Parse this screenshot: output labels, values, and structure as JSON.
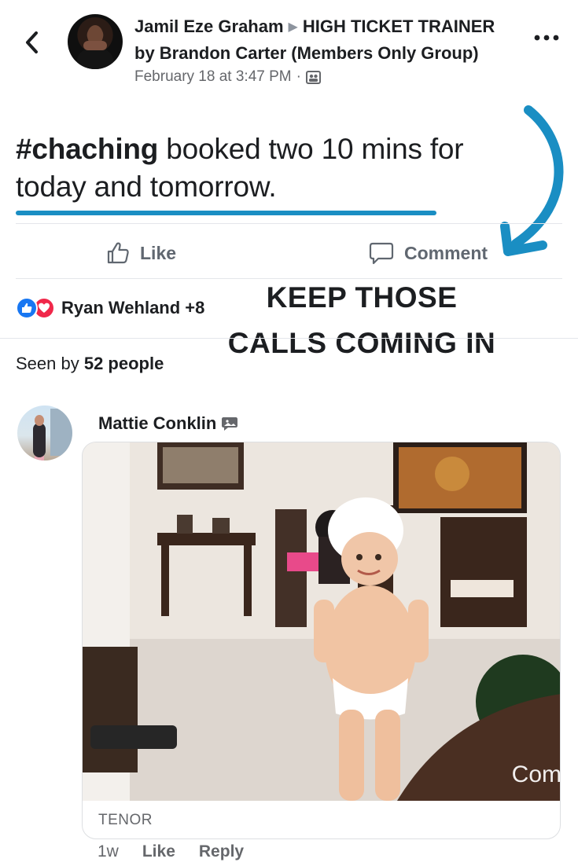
{
  "post": {
    "author": "Jamil Eze Graham",
    "group": "HIGH TICKET TRAINER by Brandon Carter (Members Only Group)",
    "timestamp": "February 18 at 3:47 PM",
    "meta_separator": "·",
    "privacy_icon": "group-members-icon",
    "hashtag": "#chaching",
    "body": " booked two 10 mins for today and tomorrow."
  },
  "actions": {
    "like_label": "Like",
    "comment_label": "Comment"
  },
  "callout": {
    "line1": "KEEP THOSE",
    "line2": "CALLS COMING IN",
    "arrow_color": "#1a8ec3"
  },
  "reactions": {
    "types": [
      "like",
      "love"
    ],
    "summary": "Ryan Wehland +8"
  },
  "seen_by": {
    "prefix": "Seen by ",
    "count": "52 people"
  },
  "comment": {
    "author": "Mattie Conklin",
    "author_badge_icon": "sticker-comment-icon",
    "gif_overlay_text": "Com",
    "gif_source": "TENOR",
    "age": "1w",
    "like_label": "Like",
    "reply_label": "Reply"
  },
  "colors": {
    "accent": "#1a8ec3",
    "like_blue": "#1877f2",
    "love_red": "#f0284a",
    "muted_text": "#65676b"
  }
}
